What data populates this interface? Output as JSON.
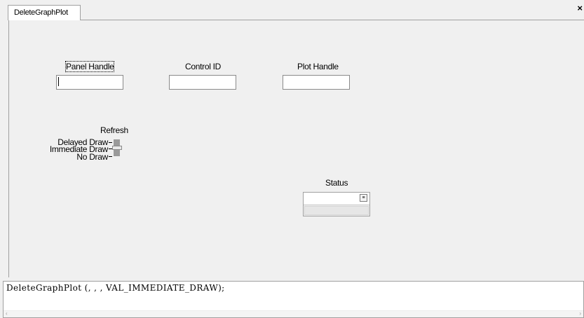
{
  "tab": {
    "label": "DeleteGraphPlot",
    "close_glyph": "×"
  },
  "fields": {
    "panel_handle": {
      "label": "Panel Handle",
      "value": ""
    },
    "control_id": {
      "label": "Control ID",
      "value": ""
    },
    "plot_handle": {
      "label": "Plot Handle",
      "value": ""
    }
  },
  "refresh": {
    "label": "Refresh",
    "options": [
      "Delayed Draw",
      "Immediate Draw",
      "No Draw"
    ],
    "selected": "Immediate Draw"
  },
  "status": {
    "label": "Status",
    "value": "",
    "button_glyph": "≡"
  },
  "code": {
    "text": "DeleteGraphPlot (, , , VAL_IMMEDIATE_DRAW);"
  },
  "scrollbar": {
    "left_arrow": "‹",
    "right_arrow": "›"
  }
}
